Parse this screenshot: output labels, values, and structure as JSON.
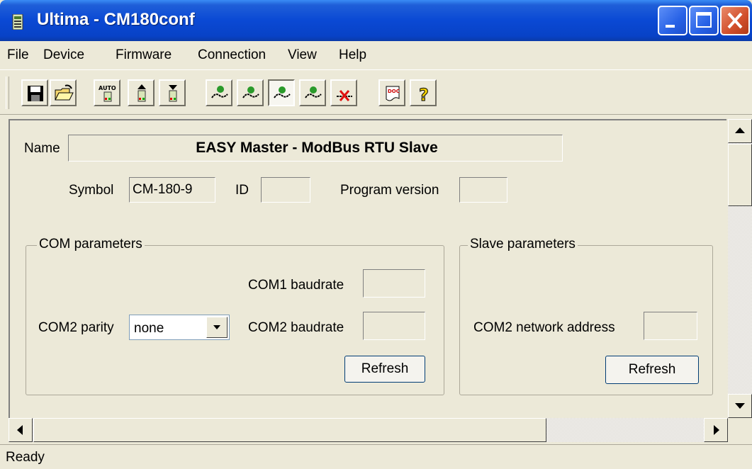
{
  "window": {
    "title": "Ultima - CM180conf"
  },
  "menu": [
    "File",
    "Device",
    "Firmware",
    "Connection",
    "View",
    "Help"
  ],
  "toolbar": {
    "icons": [
      "save-icon",
      "open-folder-icon",
      "auto-detect-icon",
      "upload-to-device-icon",
      "download-from-device-icon",
      "connect-icon",
      "connect-alt-icon",
      "connect-active-icon",
      "connect-settings-icon",
      "disconnect-icon",
      "document-icon",
      "help-icon"
    ],
    "auto_label": "AUTO",
    "doc_label": "DOC",
    "pressed_index": 7
  },
  "device": {
    "name_label": "Name",
    "name_value": "EASY Master - ModBus RTU Slave",
    "symbol_label": "Symbol",
    "symbol_value": "CM-180-9",
    "id_label": "ID",
    "id_value": "",
    "program_version_label": "Program version",
    "program_version_value": ""
  },
  "com_parameters": {
    "title": "COM parameters",
    "com1_baudrate_label": "COM1 baudrate",
    "com1_baudrate_value": "",
    "com2_parity_label": "COM2 parity",
    "com2_parity_value": "none",
    "com2_baudrate_label": "COM2 baudrate",
    "com2_baudrate_value": "",
    "refresh_label": "Refresh"
  },
  "slave_parameters": {
    "title": "Slave parameters",
    "com2_network_address_label": "COM2 network address",
    "com2_network_address_value": "",
    "refresh_label": "Refresh"
  },
  "status": {
    "text": "Ready"
  },
  "colors": {
    "titlebar": "#0a49d4",
    "face": "#ece9d8",
    "close_button": "#d14e2a"
  }
}
